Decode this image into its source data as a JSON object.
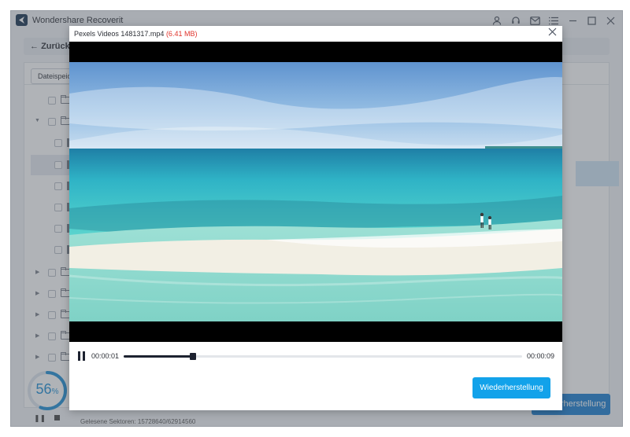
{
  "app": {
    "title": "Wondershare Recoverit",
    "titlebar_icons": [
      "user-icon",
      "headset-icon",
      "mail-icon",
      "menu-icon",
      "minimize-icon",
      "maximize-icon",
      "close-icon"
    ],
    "back_label": "Zurück",
    "tab_label": "Dateispeic",
    "recover_button": "Wiederherstellung",
    "scan_progress": {
      "value": 56,
      "number": "56",
      "unit": "%"
    },
    "sectors_text": "Gelesene Sektoren: 15728640/62914560"
  },
  "dialog": {
    "file_name": "Pexels Videos 1481317.mp4",
    "file_size": "(6.41 MB)",
    "close_icon": "close-icon",
    "current_time": "00:00:01",
    "total_time": "00:00:09",
    "playback_fraction": 0.17,
    "recover_label": "Wiederherstellung"
  },
  "colors": {
    "accent": "#12a2ea",
    "size_red": "#e0342c",
    "progress_ring": "#1e8fd6"
  }
}
